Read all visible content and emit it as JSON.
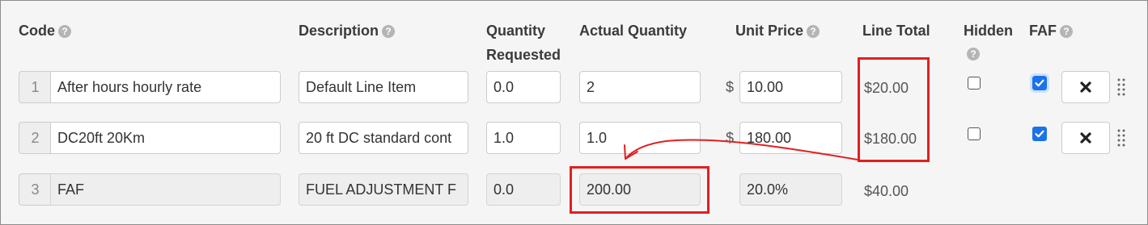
{
  "headers": {
    "code": "Code",
    "description": "Description",
    "quantity_requested_line1": "Quantity",
    "quantity_requested_line2": "Requested",
    "actual_quantity": "Actual Quantity",
    "unit_price": "Unit Price",
    "line_total": "Line Total",
    "hidden": "Hidden",
    "faf": "FAF"
  },
  "currency_symbol": "$",
  "rows": [
    {
      "num": "1",
      "code": "After hours hourly rate",
      "description": "Default Line Item",
      "quantity_requested": "0.0",
      "actual_quantity": "2",
      "unit_price": "10.00",
      "line_total": "$20.00",
      "hidden": false,
      "faf": true
    },
    {
      "num": "2",
      "code": "DC20ft 20Km",
      "description": "20 ft DC standard cont",
      "quantity_requested": "1.0",
      "actual_quantity": "1.0",
      "unit_price": "180.00",
      "line_total": "$180.00",
      "hidden": false,
      "faf": true
    },
    {
      "num": "3",
      "code": "FAF",
      "description": "FUEL ADJUSTMENT F",
      "quantity_requested": "0.0",
      "actual_quantity": "200.00",
      "unit_price": "20.0%",
      "line_total": "$40.00"
    }
  ],
  "icons": {
    "help": "question-circle-icon",
    "delete": "close-x-icon",
    "drag": "drag-handle-icon",
    "checkbox": "checkmark-icon"
  },
  "colors": {
    "annotation": "#e02020",
    "checkbox_checked": "#1a73e8",
    "help_icon": "#b5b5b5"
  }
}
